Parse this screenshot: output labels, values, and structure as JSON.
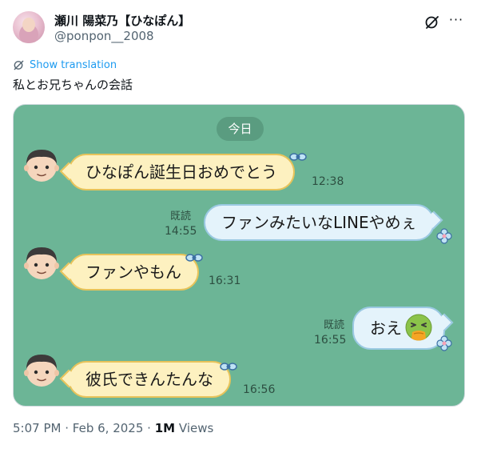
{
  "author": {
    "display_name": "瀬川 陽菜乃【ひなぽん】",
    "handle": "@ponpon__2008"
  },
  "actions": {
    "grok_icon": "grok-icon",
    "more_icon": "more-icon",
    "more_label": "···"
  },
  "translation": {
    "label": "Show translation"
  },
  "tweet": {
    "text": "私とお兄ちゃんの会話"
  },
  "chat": {
    "date": "今日",
    "messages": [
      {
        "side": "in",
        "text": "ひなぽん誕生日おめでとう",
        "time": "12:38"
      },
      {
        "side": "out",
        "text": "ファンみたいなLINEやめぇ",
        "read": "既読",
        "time": "14:55"
      },
      {
        "side": "in",
        "text": "ファンやもん",
        "time": "16:31"
      },
      {
        "side": "out",
        "text": "おえ",
        "read": "既読",
        "time": "16:55"
      },
      {
        "side": "in",
        "text": "彼氏できんたんな",
        "time": "16:56"
      }
    ],
    "colors": {
      "background": "#6cb596",
      "incoming_bubble": "#fdf1c0",
      "outgoing_bubble": "#e4f3fb"
    }
  },
  "meta": {
    "time": "5:07 PM",
    "separator": "·",
    "date": "Feb 6, 2025",
    "views_count": "1M",
    "views_label": "Views"
  }
}
